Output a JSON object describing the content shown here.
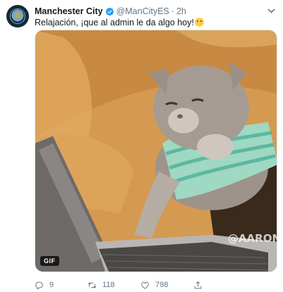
{
  "tweet": {
    "author": {
      "display_name": "Manchester City",
      "handle": "@ManCityES",
      "separator": "·",
      "time": "2h",
      "verified": true
    },
    "text": "Relajación, ¡que al admin le da algo hoy!",
    "emoji": "flushed-face",
    "media": {
      "type": "gif",
      "badge": "GIF",
      "watermark": "@AARON"
    },
    "actions": {
      "replies": "9",
      "retweets": "118",
      "likes": "798"
    }
  },
  "colors": {
    "verified": "#1da1f2",
    "secondary_text": "#657786",
    "primary_text": "#14171a"
  }
}
